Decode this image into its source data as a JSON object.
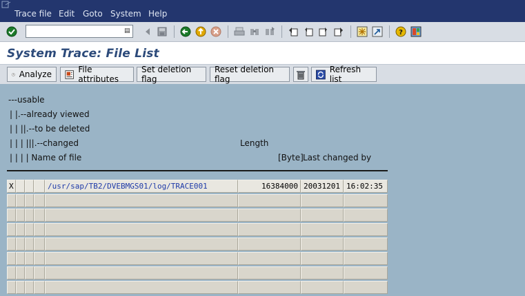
{
  "menubar": {
    "items": [
      {
        "id": "trace-file",
        "label": "Trace file"
      },
      {
        "id": "edit",
        "label": "Edit"
      },
      {
        "id": "goto",
        "label": "Goto"
      },
      {
        "id": "system",
        "label": "System"
      },
      {
        "id": "help",
        "label": "Help"
      }
    ]
  },
  "toolbar": {
    "command_value": "",
    "icons": [
      "enter-icon",
      "back-icon",
      "save-icon",
      "back-nav-icon",
      "exit-icon",
      "cancel-icon",
      "print-icon",
      "find-icon",
      "find-next-icon",
      "first-page-icon",
      "previous-page-icon",
      "next-page-icon",
      "last-page-icon",
      "create-session-icon",
      "shortcut-icon",
      "help-icon",
      "layout-icon"
    ]
  },
  "title": "System Trace: File List",
  "app_toolbar": {
    "analyze": "Analyze",
    "file_attributes": "File attributes",
    "set_deletion_flag": "Set deletion flag",
    "reset_deletion_flag": "Reset deletion flag",
    "refresh_list": "Refresh list"
  },
  "legend": {
    "line1": "---usable",
    "line2": "| |.--already viewed",
    "line3": "| | ||.--to be deleted",
    "line4": "| | | |||.--changed",
    "line5": "| | | | Name of file",
    "length_label": "Length",
    "byte_label": "[Byte]",
    "last_changed_label": "Last changed by"
  },
  "rows": [
    {
      "usable": "X",
      "viewed": "",
      "deleted": "",
      "changed": "",
      "name": "/usr/sap/TB2/DVEBMGS01/log/TRACE001",
      "length": "16384000",
      "date": "20031201",
      "time": "16:02:35"
    },
    {
      "usable": "",
      "viewed": "",
      "deleted": "",
      "changed": "",
      "name": "",
      "length": "",
      "date": "",
      "time": ""
    },
    {
      "usable": "",
      "viewed": "",
      "deleted": "",
      "changed": "",
      "name": "",
      "length": "",
      "date": "",
      "time": ""
    },
    {
      "usable": "",
      "viewed": "",
      "deleted": "",
      "changed": "",
      "name": "",
      "length": "",
      "date": "",
      "time": ""
    },
    {
      "usable": "",
      "viewed": "",
      "deleted": "",
      "changed": "",
      "name": "",
      "length": "",
      "date": "",
      "time": ""
    },
    {
      "usable": "",
      "viewed": "",
      "deleted": "",
      "changed": "",
      "name": "",
      "length": "",
      "date": "",
      "time": ""
    },
    {
      "usable": "",
      "viewed": "",
      "deleted": "",
      "changed": "",
      "name": "",
      "length": "",
      "date": "",
      "time": ""
    },
    {
      "usable": "",
      "viewed": "",
      "deleted": "",
      "changed": "",
      "name": "",
      "length": "",
      "date": "",
      "time": ""
    }
  ],
  "colors": {
    "menubar": "#23366e",
    "background": "#9ab4c6",
    "title": "#2c4a7a",
    "filename": "#1e3aa8"
  }
}
